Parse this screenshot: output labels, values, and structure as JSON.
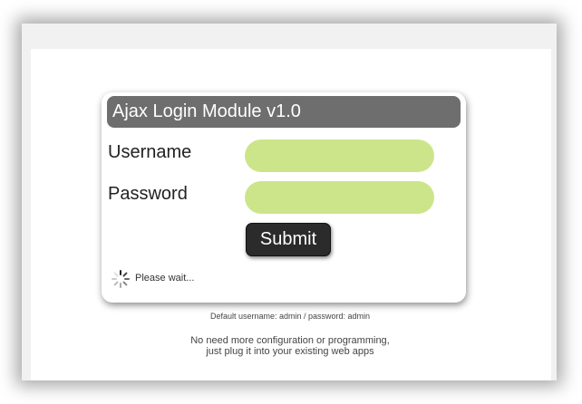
{
  "login": {
    "title": "Ajax Login Module v1.0",
    "username_label": "Username",
    "username_value": "",
    "password_label": "Password",
    "password_value": "",
    "submit_label": "Submit",
    "status_text": "Please wait..."
  },
  "footer": {
    "hint": "Default username: admin / password: admin",
    "tagline_line1": "No need more configuration or programming,",
    "tagline_line2": "just plug it into your existing web apps"
  },
  "colors": {
    "title_bar": "#6e6e6e",
    "input_fill": "#cce58a",
    "button_fill": "#2b2b2b"
  },
  "icons": {
    "status": "spinner-icon"
  }
}
